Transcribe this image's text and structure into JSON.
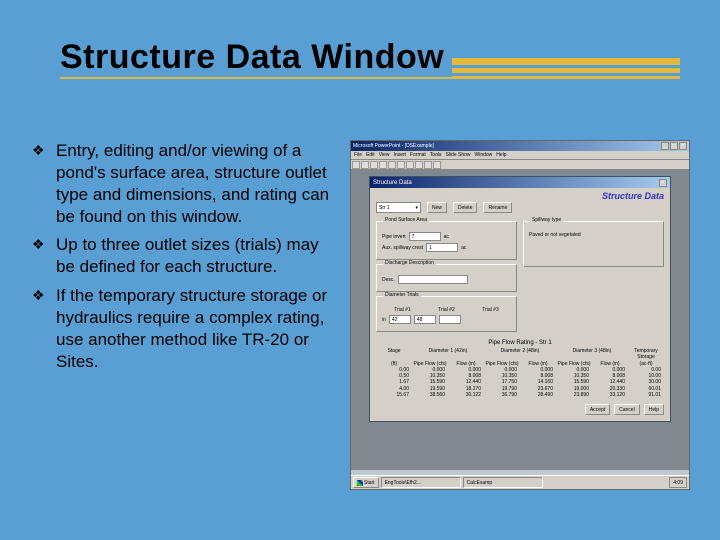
{
  "slide": {
    "title": "Structure Data Window",
    "bullets": [
      "Entry, editing and/or viewing of a pond's surface area, structure outlet type and dimensions, and rating can be found on this window.",
      "Up to three outlet sizes (trials) may be defined for each structure.",
      "If the temporary structure storage or hydraulics require a complex rating, use another method like TR-20 or Sites."
    ]
  },
  "screenshot": {
    "outer_title": "Microsoft PowerPoint - [DSExample]",
    "menubar": [
      "File",
      "Edit",
      "View",
      "Insert",
      "Format",
      "Tools",
      "Slide Show",
      "Window",
      "Help"
    ],
    "window": {
      "title": "Structure Data",
      "header_label": "Structure Data",
      "struct_dropdown": "Str 1",
      "buttons_top": [
        "New",
        "Delete",
        "Rename"
      ],
      "group_pond": {
        "title": "Pond Surface Area",
        "pipe_invert_label": "Pipe invert",
        "pipe_invert_value": "7",
        "pipe_invert_unit": "ac",
        "aux_spillway_label": "Aux. spillway crest",
        "aux_spillway_value": "1",
        "aux_spillway_unit": "ac"
      },
      "group_discharge": {
        "title": "Discharge Description",
        "desc_label": "Desc.",
        "desc_value": "",
        "spillway_label": "Spillway type",
        "spillway_value": "Paved or not vegetated"
      },
      "group_diameter": {
        "title": "Diameter Trials",
        "diameter_in_label": "in",
        "trial1_label": "Trial #1",
        "trial1_value": "42",
        "trial2_label": "Trial #2",
        "trial2_value": "48",
        "trial3_label": "Trial #3",
        "trial3_value": ""
      },
      "rating_title": "Pipe Flow Rating - Str 1",
      "rating_cols": [
        {
          "top": "Stage",
          "sub": "(ft)"
        },
        {
          "top": "Diameter 1 (42in)",
          "sub_left": "Pipe Flow (cfs)",
          "sub_right": "Flow (in)"
        },
        {
          "top": "Diameter 2 (48in)",
          "sub_left": "Pipe Flow (cfs)",
          "sub_right": "Flow (in)"
        },
        {
          "top": "Diameter 3 (48in)",
          "sub_left": "Pipe Flow (cfs)",
          "sub_right": "Flow (in)"
        },
        {
          "top": "Temporary Storage",
          "sub": "(ac-ft)"
        }
      ],
      "rating_rows": [
        [
          "0.00",
          "0.000",
          "0.000",
          "0.000",
          "0.000",
          "0.000",
          "0.000",
          "0.00"
        ],
        [
          "0.50",
          "10.350",
          "8.008",
          "10.350",
          "8.008",
          "10.350",
          "8.008",
          "10.00"
        ],
        [
          "1.67",
          "15.590",
          "12.440",
          "17.750",
          "14.160",
          "15.590",
          "12.440",
          "30.00"
        ],
        [
          "4.00",
          "19.590",
          "18.170",
          "19.790",
          "23.670",
          "19.000",
          "20.330",
          "60.01"
        ],
        [
          "15.67",
          "38.560",
          "30.122",
          "36.790",
          "28.490",
          "23.890",
          "33.120",
          "91.01"
        ]
      ],
      "bottom_buttons": [
        "Accept",
        "Cancel",
        "Help"
      ]
    },
    "taskbar": {
      "start": "Start",
      "items": [
        "EngTools\\Efh2...",
        "CalcExamp"
      ],
      "clock": "4:09"
    }
  }
}
